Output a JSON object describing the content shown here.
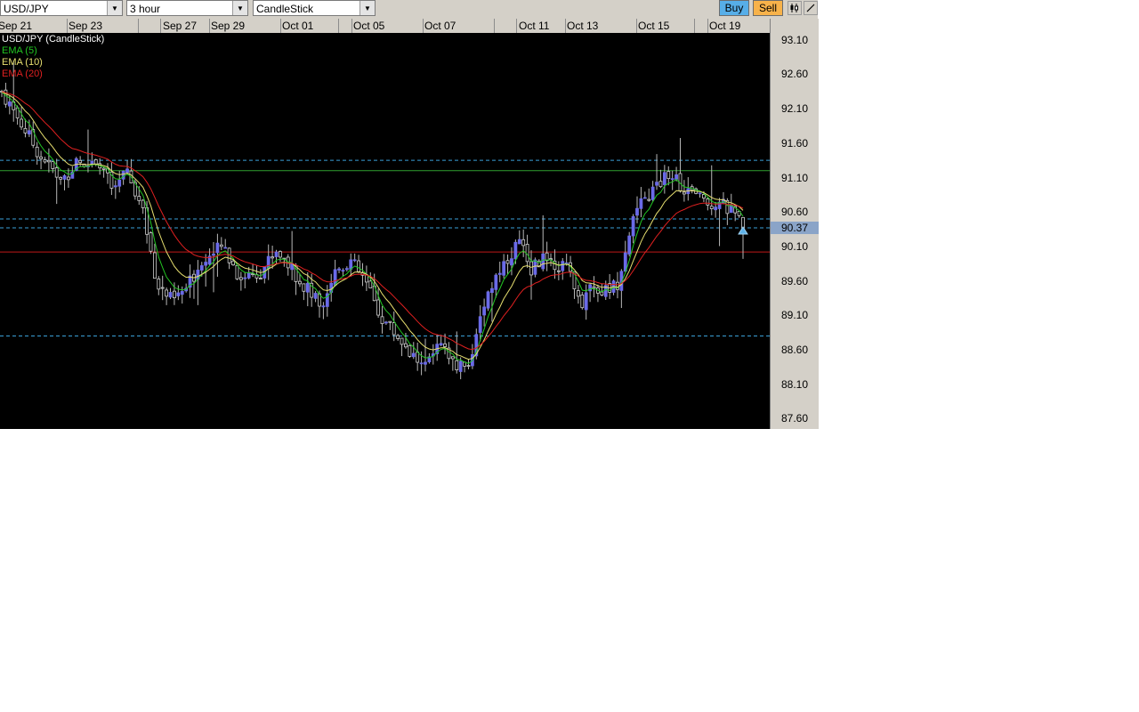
{
  "toolbar": {
    "symbol": "USD/JPY",
    "timeframe": "3 hour",
    "chart_type": "CandleStick",
    "buy_label": "Buy",
    "sell_label": "Sell",
    "tools": [
      "candlestick-tool-icon",
      "draw-line-tool-icon"
    ]
  },
  "colors": {
    "background": "#000000",
    "bull_candle": "#6a6ae8",
    "bear_candle": "#cfcfcf",
    "ema5": "#22c522",
    "ema10": "#e8e070",
    "ema20": "#e02020",
    "support_resistance": "#3aa0d8",
    "horizontal_green": "#2fa02f",
    "horizontal_red": "#c01818"
  },
  "chart_data": {
    "type": "candlestick",
    "title": "USD/JPY (CandleStick)",
    "timeframe": "3 hour",
    "date_ticks": [
      "Sep 21",
      "Sep 23",
      "Sep 27",
      "Sep 29",
      "Oct 01",
      "Oct 05",
      "Oct 07",
      "Oct 11",
      "Oct 13",
      "Oct 15",
      "Oct 19"
    ],
    "y_ticks": [
      93.1,
      92.6,
      92.1,
      91.6,
      91.1,
      90.6,
      90.1,
      89.6,
      89.1,
      88.6,
      88.1,
      87.6
    ],
    "y_tick_labels": [
      "93.10",
      "92.60",
      "92.10",
      "91.60",
      "91.10",
      "90.60",
      "90.10",
      "89.60",
      "89.10",
      "88.60",
      "88.10",
      "87.60"
    ],
    "ylim": [
      87.45,
      93.2
    ],
    "current_price": "90.37",
    "legend": [
      {
        "name": "USD/JPY (CandleStick)",
        "color": "#ffffff"
      },
      {
        "name": "EMA (5)",
        "color": "#22c522"
      },
      {
        "name": "EMA (10)",
        "color": "#e8e070"
      },
      {
        "name": "EMA (20)",
        "color": "#e02020"
      }
    ],
    "close_path": [
      {
        "t": 0,
        "v": 92.35
      },
      {
        "t": 0.02,
        "v": 92.0
      },
      {
        "t": 0.05,
        "v": 91.45
      },
      {
        "t": 0.08,
        "v": 91.05
      },
      {
        "t": 0.1,
        "v": 91.3
      },
      {
        "t": 0.13,
        "v": 91.4
      },
      {
        "t": 0.15,
        "v": 90.9
      },
      {
        "t": 0.17,
        "v": 91.2
      },
      {
        "t": 0.19,
        "v": 90.6
      },
      {
        "t": 0.21,
        "v": 89.55
      },
      {
        "t": 0.23,
        "v": 89.3
      },
      {
        "t": 0.25,
        "v": 89.5
      },
      {
        "t": 0.27,
        "v": 89.9
      },
      {
        "t": 0.3,
        "v": 90.1
      },
      {
        "t": 0.32,
        "v": 89.65
      },
      {
        "t": 0.35,
        "v": 89.75
      },
      {
        "t": 0.37,
        "v": 90.05
      },
      {
        "t": 0.39,
        "v": 89.8
      },
      {
        "t": 0.41,
        "v": 89.5
      },
      {
        "t": 0.43,
        "v": 89.25
      },
      {
        "t": 0.45,
        "v": 89.75
      },
      {
        "t": 0.47,
        "v": 89.9
      },
      {
        "t": 0.49,
        "v": 89.6
      },
      {
        "t": 0.51,
        "v": 89.1
      },
      {
        "t": 0.53,
        "v": 88.85
      },
      {
        "t": 0.55,
        "v": 88.6
      },
      {
        "t": 0.57,
        "v": 88.3
      },
      {
        "t": 0.59,
        "v": 88.65
      },
      {
        "t": 0.61,
        "v": 88.4
      },
      {
        "t": 0.63,
        "v": 88.35
      },
      {
        "t": 0.65,
        "v": 89.3
      },
      {
        "t": 0.67,
        "v": 89.75
      },
      {
        "t": 0.69,
        "v": 90.05
      },
      {
        "t": 0.7,
        "v": 90.2
      },
      {
        "t": 0.71,
        "v": 89.75
      },
      {
        "t": 0.73,
        "v": 89.95
      },
      {
        "t": 0.75,
        "v": 89.85
      },
      {
        "t": 0.77,
        "v": 89.7
      },
      {
        "t": 0.78,
        "v": 89.2
      },
      {
        "t": 0.79,
        "v": 89.55
      },
      {
        "t": 0.81,
        "v": 89.45
      },
      {
        "t": 0.83,
        "v": 89.55
      },
      {
        "t": 0.85,
        "v": 90.5
      },
      {
        "t": 0.87,
        "v": 90.8
      },
      {
        "t": 0.89,
        "v": 91.05
      },
      {
        "t": 0.9,
        "v": 91.2
      },
      {
        "t": 0.92,
        "v": 90.95
      },
      {
        "t": 0.94,
        "v": 90.8
      },
      {
        "t": 0.96,
        "v": 90.75
      },
      {
        "t": 0.98,
        "v": 90.65
      },
      {
        "t": 1.0,
        "v": 90.37
      }
    ],
    "horizontal_lines": [
      {
        "value": 91.35,
        "style": "dashed",
        "color": "#3aa0d8"
      },
      {
        "value": 91.2,
        "style": "solid",
        "color": "#2fa02f"
      },
      {
        "value": 90.5,
        "style": "dashed",
        "color": "#3aa0d8"
      },
      {
        "value": 90.37,
        "style": "dashed",
        "color": "#3aa0d8"
      },
      {
        "value": 90.02,
        "style": "solid",
        "color": "#c01818"
      },
      {
        "value": 88.8,
        "style": "dashed",
        "color": "#3aa0d8"
      }
    ],
    "series": [
      {
        "name": "EMA (5)",
        "period": 5
      },
      {
        "name": "EMA (10)",
        "period": 10
      },
      {
        "name": "EMA (20)",
        "period": 20
      }
    ]
  }
}
